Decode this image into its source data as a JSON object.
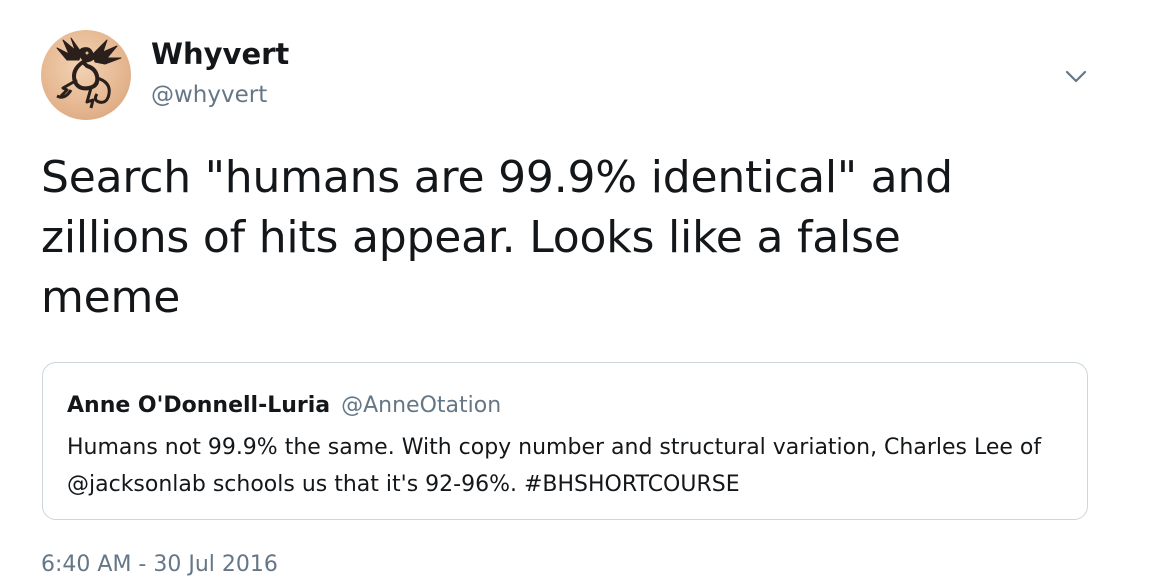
{
  "author": {
    "display_name": "Whyvert",
    "handle": "@whyvert",
    "avatar_icon": "dragon-avatar"
  },
  "menu": {
    "icon": "chevron-down-icon"
  },
  "tweet": {
    "text": "Search \"humans are 99.9% identical\" and zillions of hits appear. Looks like a false meme",
    "timestamp": "6:40 AM - 30 Jul 2016"
  },
  "quoted_tweet": {
    "display_name": "Anne O'Donnell-Luria",
    "handle": "@AnneOtation",
    "text": "Humans not 99.9% the same. With copy number and structural variation, Charles Lee of @jacksonlab schools us that it's 92-96%. #BHSHORTCOURSE"
  },
  "colors": {
    "text_primary": "#14171a",
    "text_secondary": "#657786",
    "border": "#ccd6dd"
  }
}
